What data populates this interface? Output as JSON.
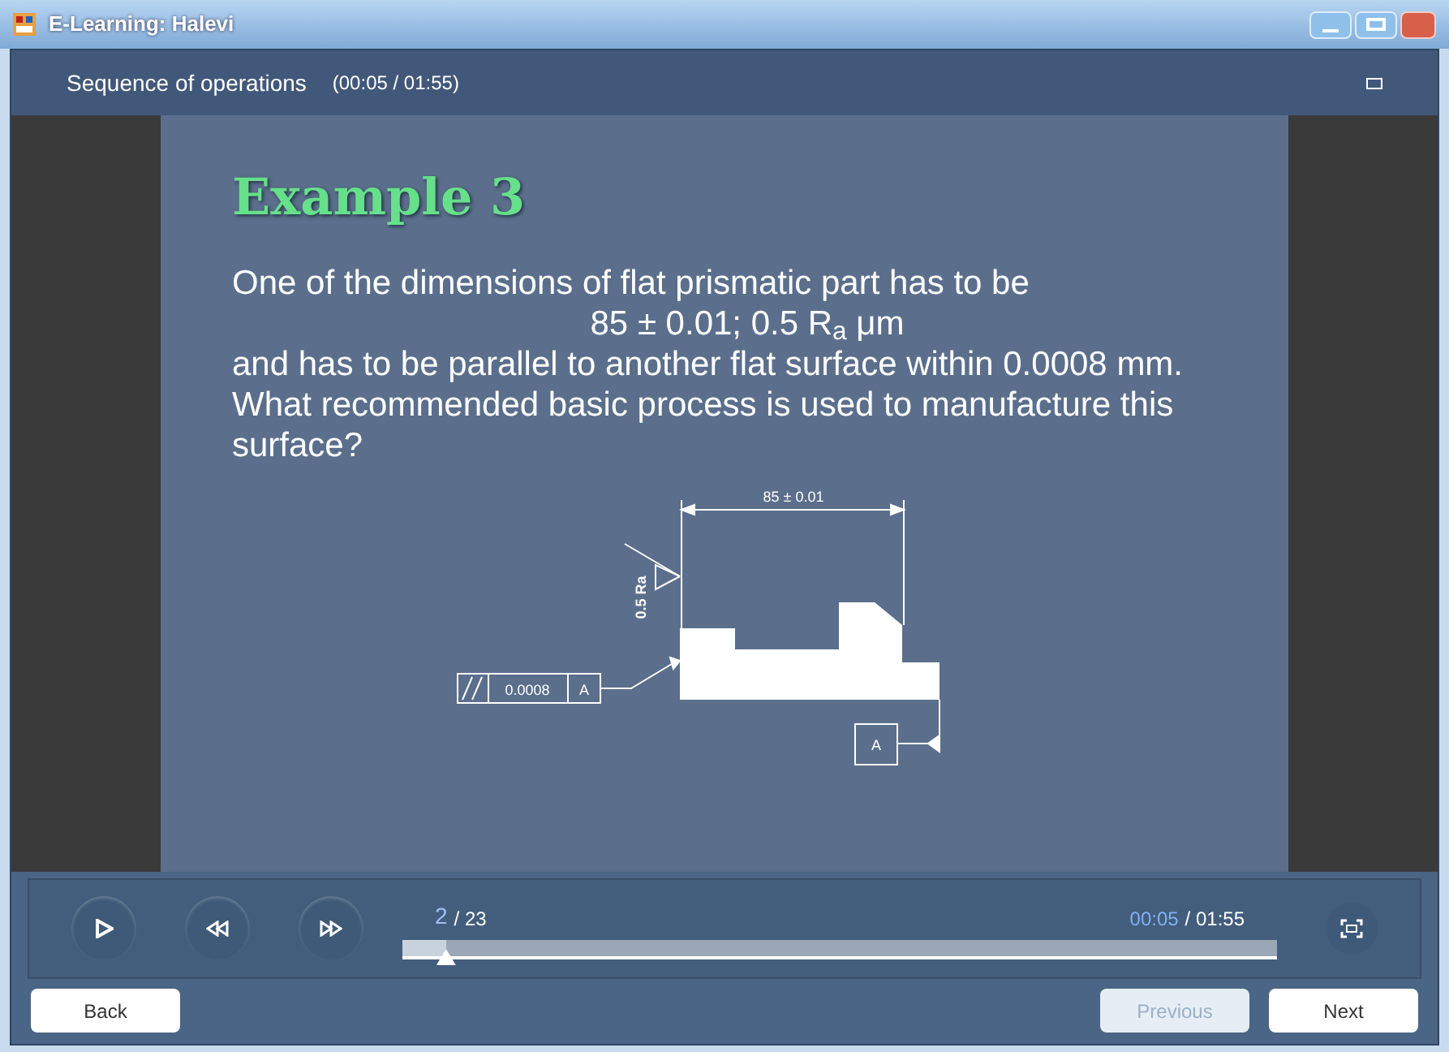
{
  "window": {
    "title": "E-Learning: Halevi"
  },
  "header": {
    "title": "Sequence of operations",
    "time": "(00:05 / 01:55)"
  },
  "slide": {
    "title": "Example 3",
    "lines": [
      {
        "text": "One of the dimensions of flat prismatic part has to be",
        "kind": "text"
      },
      {
        "text": "85 ± 0.01; 0.5 R$_{a}$ μm",
        "kind": "equation"
      },
      {
        "text": "and has to be parallel to another flat surface within 0.0008 mm.",
        "kind": "text"
      },
      {
        "text": "What recommended basic process is used to manufacture this surface?",
        "kind": "text"
      }
    ],
    "drawing": {
      "dimension": "85 ± 0.01",
      "roughness": "0.5 Ra",
      "tolerance": "0.0008",
      "datum_ref": "A",
      "datum": "A"
    }
  },
  "player": {
    "slide_current": "2",
    "slide_total": "/ 23",
    "time_current": "00:05",
    "time_total": "/ 01:55",
    "level": 0.05
  },
  "buttons": [
    {
      "label": "Back",
      "disabled": false
    },
    {
      "label": "Previous",
      "disabled": true
    },
    {
      "label": "Next",
      "disabled": false
    }
  ]
}
